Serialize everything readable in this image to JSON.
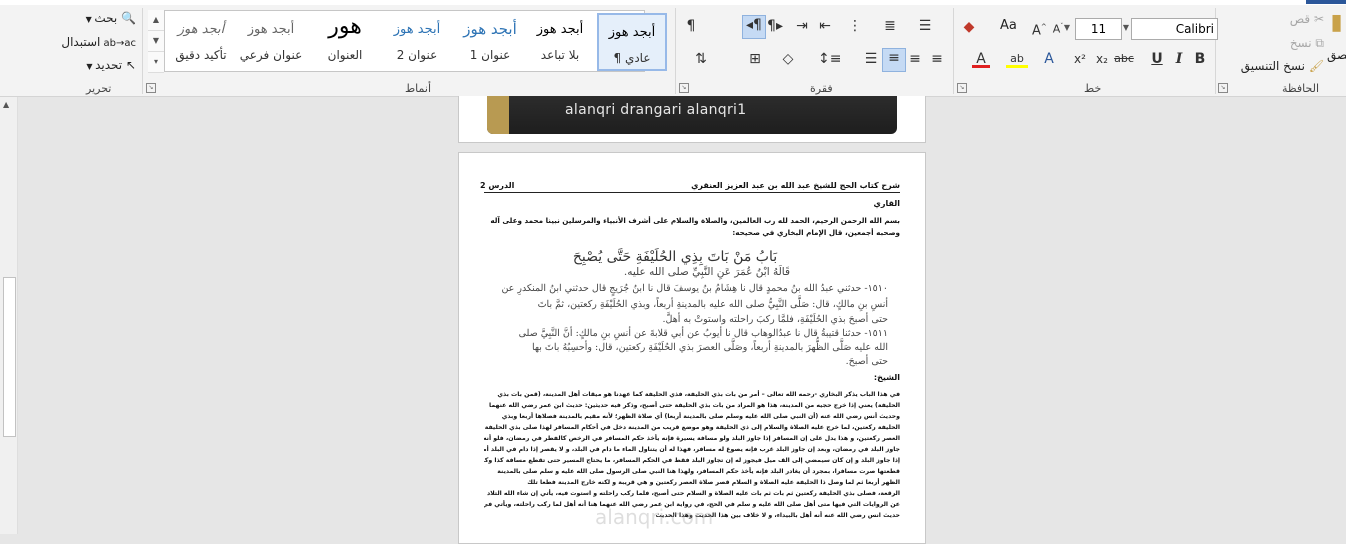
{
  "ribbon": {
    "clipboard": {
      "paste_label": "لصق",
      "cut_label": "قص",
      "copy_label": "نسخ",
      "format_painter_label": "نسخ التنسيق",
      "group_label": "الحافظة"
    },
    "font": {
      "font_name": "Calibri (أساسي)",
      "font_size": "11",
      "case_label": "Aa",
      "group_label": "خط"
    },
    "paragraph": {
      "group_label": "فقرة"
    },
    "styles": {
      "group_label": "أنماط",
      "items": [
        {
          "sample": "أبجد هوز",
          "name": "¶ عادي"
        },
        {
          "sample": "أبجد هوز",
          "name": "بلا تباعد"
        },
        {
          "sample": "أبجد هوز",
          "name": "عنوان 1"
        },
        {
          "sample": "أبجد هوز",
          "name": "عنوان 2"
        },
        {
          "sample": "هور",
          "name": "العنوان"
        },
        {
          "sample": "أبجد هوز",
          "name": "عنوان فرعي"
        },
        {
          "sample": "أبجد هوز",
          "name": "تأكيد دقيق"
        }
      ]
    },
    "editing": {
      "find_label": "بحث",
      "replace_label": "استبدال",
      "select_label": "تحديد",
      "group_label": "تحرير"
    }
  },
  "document": {
    "banner_text": "alanqri  drangari  alanqri1",
    "header_left": "الدرس 2",
    "header_right": "شرح كتاب الحج للشيخ عبد الله بن عبد العزيز العنقري",
    "reader_label": "القاري",
    "intro_text": "بسم الله الرحمن الرحيم، الحمد لله رب العالمين، والصلاة والسلام على أشرف الأنبياء والمرسلين نبينا محمد وعلى آله وصحبه أجمعين، قال الإمام البخاري في صحيحه:",
    "chapter_title": "بَابُ مَنْ بَاتَ بِذِي الحُلَيْفَةِ حَتَّى يُصْبِحَ",
    "scan_lines": [
      "قَالَهُ ابْنُ عُمَرَ عَنِ النَّبِيِّ صلى الله عليه.",
      "١٥١٠- حدثني عبدُ الله بنُ محمدٍ قال نا هِشَامُ بنُ يوسفَ قال نا ابنُ جُرَيجٍ قال حدثني ابنُ المنكدرِ عن",
      "أنسِ بنِ مالكٍ، قال: صَلَّى النَّبِيُّ صلى الله عليه بالمدينةِ أربعاً، وبذي الحُلَيْفَةِ ركعتين، ثمَّ باتَ",
      "حتى أصبحَ بذي الحُلَيْفَةِ، فلمَّا ركبَ راحلته واستوتْ به أهلَّ.",
      "١٥١١- حدثنا قتيبةُ قال نا عبدُالوهاب قال نا أيوبُ عن أبي قلابةَ عن أنسِ بنِ مالكٍ: أنَّ النَّبِيَّ صلى",
      "الله عليه صَلَّى الظُّهرَ بالمدينةِ أربعاً، وصَلَّى العصرَ بذي الحُلَيْفَةِ ركعتين، قال: وأحسِبُهُ باتَ بها",
      "حتى أصبحَ."
    ],
    "sheikh_label": "الشيخ:",
    "body_lines": [
      "في هذا الباب يذكر البخاري -رحمه الله تعالى – أمر من بات بذي الحليفة، فذي الحليفة كما عهدنا هو ميقات أهل المدينة، (قمن بات بذي",
      "الحليفة) يعني إذا خرج حجيه من المدينة، هذا هو المراد من بات بذي الحليفة حتى أصبح، وذكر فيه حديثين: حديث ابن عمر رضي الله عنهما",
      "وحديث أنس رضي الله عنه (أن النبي صلى الله عليه وسلم صلى بالمدينة أربعا) أي صلاة الظهر؛ لأنه مقيم بالمدينة فصلاها أربعا وبذي",
      "الحليفة ركعتين، لما خرج عليه الصلاة والسلام إلى ذي الحليفة وهو موضع قريب من المدينة دخل في أحكام المسافر لهذا صلى بذي الحليفة",
      "العصر ركعتين، و هذا يدل على إن المسافر إذا جاوز البلد ولو مسافة يسيرة فإنه يأخذ حكم المسافر في الرخص كالفطر في رمضان، فلو أنه",
      "جاوز البلد في رمضان، وبعد إن جاوز البلد غرب فإنه يصوغ له مسافر، فهذا له أن يتناول الماء ما دام في البلد، و لا يقصر إذا دام في البلد أما",
      "إذا جاوز البلد و إن كان سيمضي إلى الف ميل فيجوز له إن تجاوز البلد فقط في الحكم المسافر، ما يحتاج المسير حتى تقطع مسافة كذا وكذا، فإذا",
      "قطعتها صرت مسافرا، بمجرد أن يغادر البلد فإنه يأخذ حكم المسافر، ولهذا هنا النبي صلى الرسول صلى الله عليه و سلم صلى بالمدينة",
      "الظهر أربعا ثم لما وصل ذا الحليفة عليه الصلاة و السلام قصر صلاة العصر ركعتين و هي قريبة و لكنه خارج المدينة فطعا تلك",
      "الرقعة، فصلى بذي الحليفة ركعتين ثم بات ثم بات عليه الصلاة و السلام حتى أصبح، فلما ركب راحلته و استوت فيه، يأتي إن شاء الله التلاد",
      "عن الروايات التي فيها متى أهل صلى الله عليه و سلم في الحج، في رواية ابن عمر رضي الله عنهما هنا أنه أهل لما ركب راحلته، ويأتي في",
      "حديث انس رضي الله عنه أنه أهل بالبيداء، و لا خلاف بين هذا الحديث وهذا الحديث"
    ],
    "watermark": "alanqri.com"
  }
}
